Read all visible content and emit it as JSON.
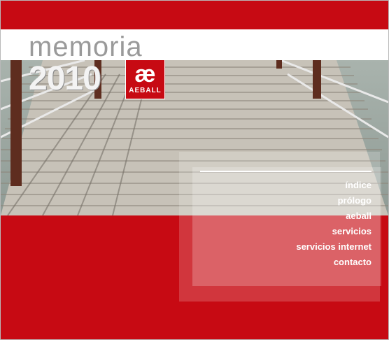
{
  "logo": {
    "word": "memoria",
    "year": "2010",
    "brand": "AEBALL",
    "mark_glyph": "æ",
    "colors": {
      "red": "#c70a13",
      "grey": "#9a9a9a"
    }
  },
  "menu": {
    "items": [
      {
        "label": "índice"
      },
      {
        "label": "prólogo"
      },
      {
        "label": "aeball"
      },
      {
        "label": "servicios"
      },
      {
        "label": "servicios  internet"
      },
      {
        "label": "contacto"
      }
    ]
  }
}
